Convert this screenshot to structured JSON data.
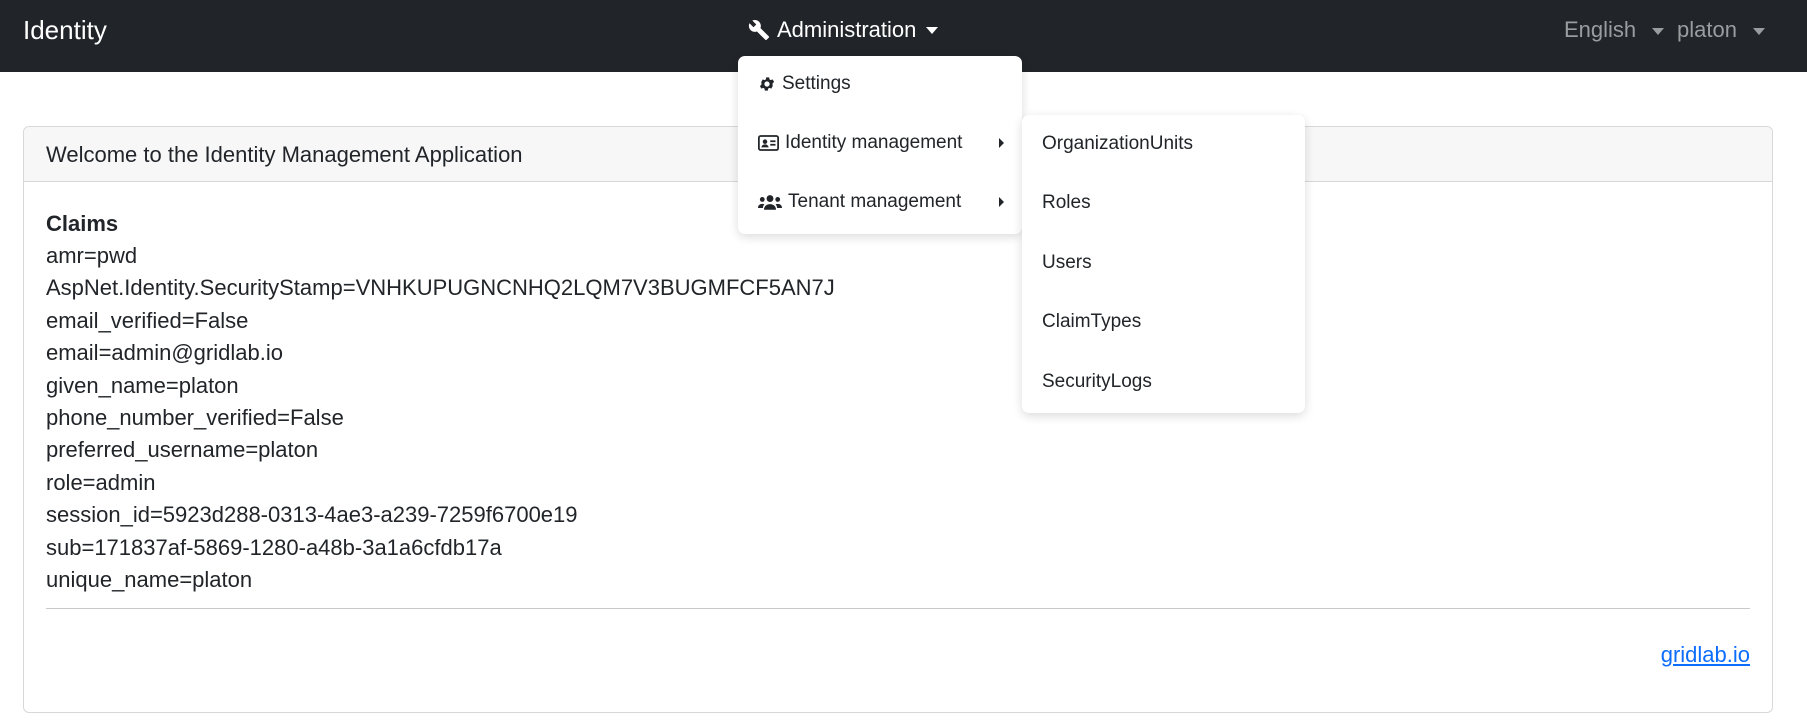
{
  "navbar": {
    "brand": "Identity",
    "admin_label": "Administration",
    "language_label": "English",
    "user_label": "platon"
  },
  "admin_menu": {
    "items": [
      {
        "label": "Settings",
        "icon": "gear-icon"
      },
      {
        "label": "Identity management",
        "icon": "id-card-icon"
      },
      {
        "label": "Tenant management",
        "icon": "users-icon"
      }
    ]
  },
  "identity_submenu": {
    "items": [
      {
        "label": "OrganizationUnits"
      },
      {
        "label": "Roles"
      },
      {
        "label": "Users"
      },
      {
        "label": "ClaimTypes"
      },
      {
        "label": "SecurityLogs"
      }
    ]
  },
  "card": {
    "header": "Welcome to the Identity Management Application",
    "claims_title": "Claims",
    "claims": [
      "amr=pwd",
      "AspNet.Identity.SecurityStamp=VNHKUPUGNCNHQ2LQM7V3BUGMFCF5AN7J",
      "email_verified=False",
      "email=admin@gridlab.io",
      "given_name=platon",
      "phone_number_verified=False",
      "preferred_username=platon",
      "role=admin",
      "session_id=5923d288-0313-4ae3-a239-7259f6700e19",
      "sub=171837af-5869-1280-a48b-3a1a6cfdb17a",
      "unique_name=platon"
    ],
    "footer_link": "gridlab.io"
  },
  "colors": {
    "navbar_bg": "#212529",
    "link": "#0d6efd",
    "nav_muted": "#9a9da0"
  }
}
